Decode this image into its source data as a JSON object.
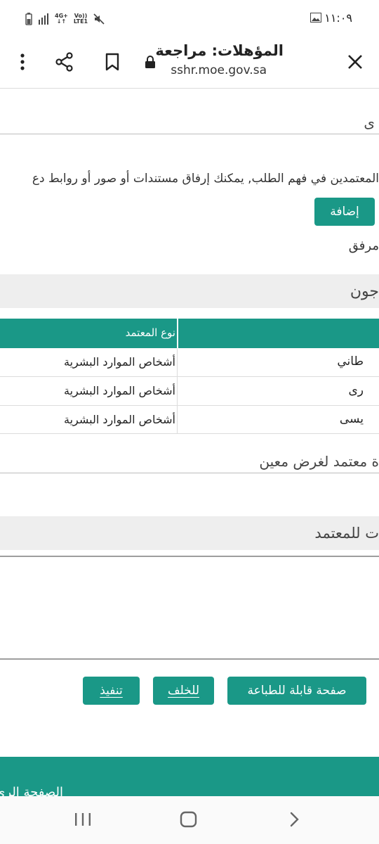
{
  "status_bar": {
    "time": "١١:٠٩",
    "network_top": "4G+",
    "network_bottom": "LTE1",
    "volte_top": "Vo))",
    "volte_bottom": "LTE1"
  },
  "browser": {
    "page_title": "المؤهلات: مراجعة",
    "url": "sshr.moe.gov.sa"
  },
  "page": {
    "top_text_fragment": "ى",
    "attachment_hint": "المعتمدين في فهم الطلب, يمكنك إرفاق مستندات أو صور أو روابط دع",
    "add_button": "إضافة",
    "attachment_label": "مرفق",
    "approvers_section": "جون",
    "table": {
      "headers": [
        "",
        "نوع المعتمد"
      ],
      "rows": [
        [
          "طاني",
          "أشخاص الموارد البشرية"
        ],
        [
          "رى",
          "أشخاص الموارد البشرية"
        ],
        [
          "يسى",
          "أشخاص الموارد البشرية"
        ]
      ]
    },
    "approver_for_purpose": "ة معتمد لغرض معين",
    "notes_section": "ت للمعتمد",
    "buttons": {
      "printable": "صفحة قابلة للطباعة",
      "back": "للخلف",
      "submit": "تنفيذ"
    },
    "footer_link": "الصفحة الرئ"
  },
  "colors": {
    "accent": "#1a9887",
    "section_bg": "#eeeeee"
  }
}
